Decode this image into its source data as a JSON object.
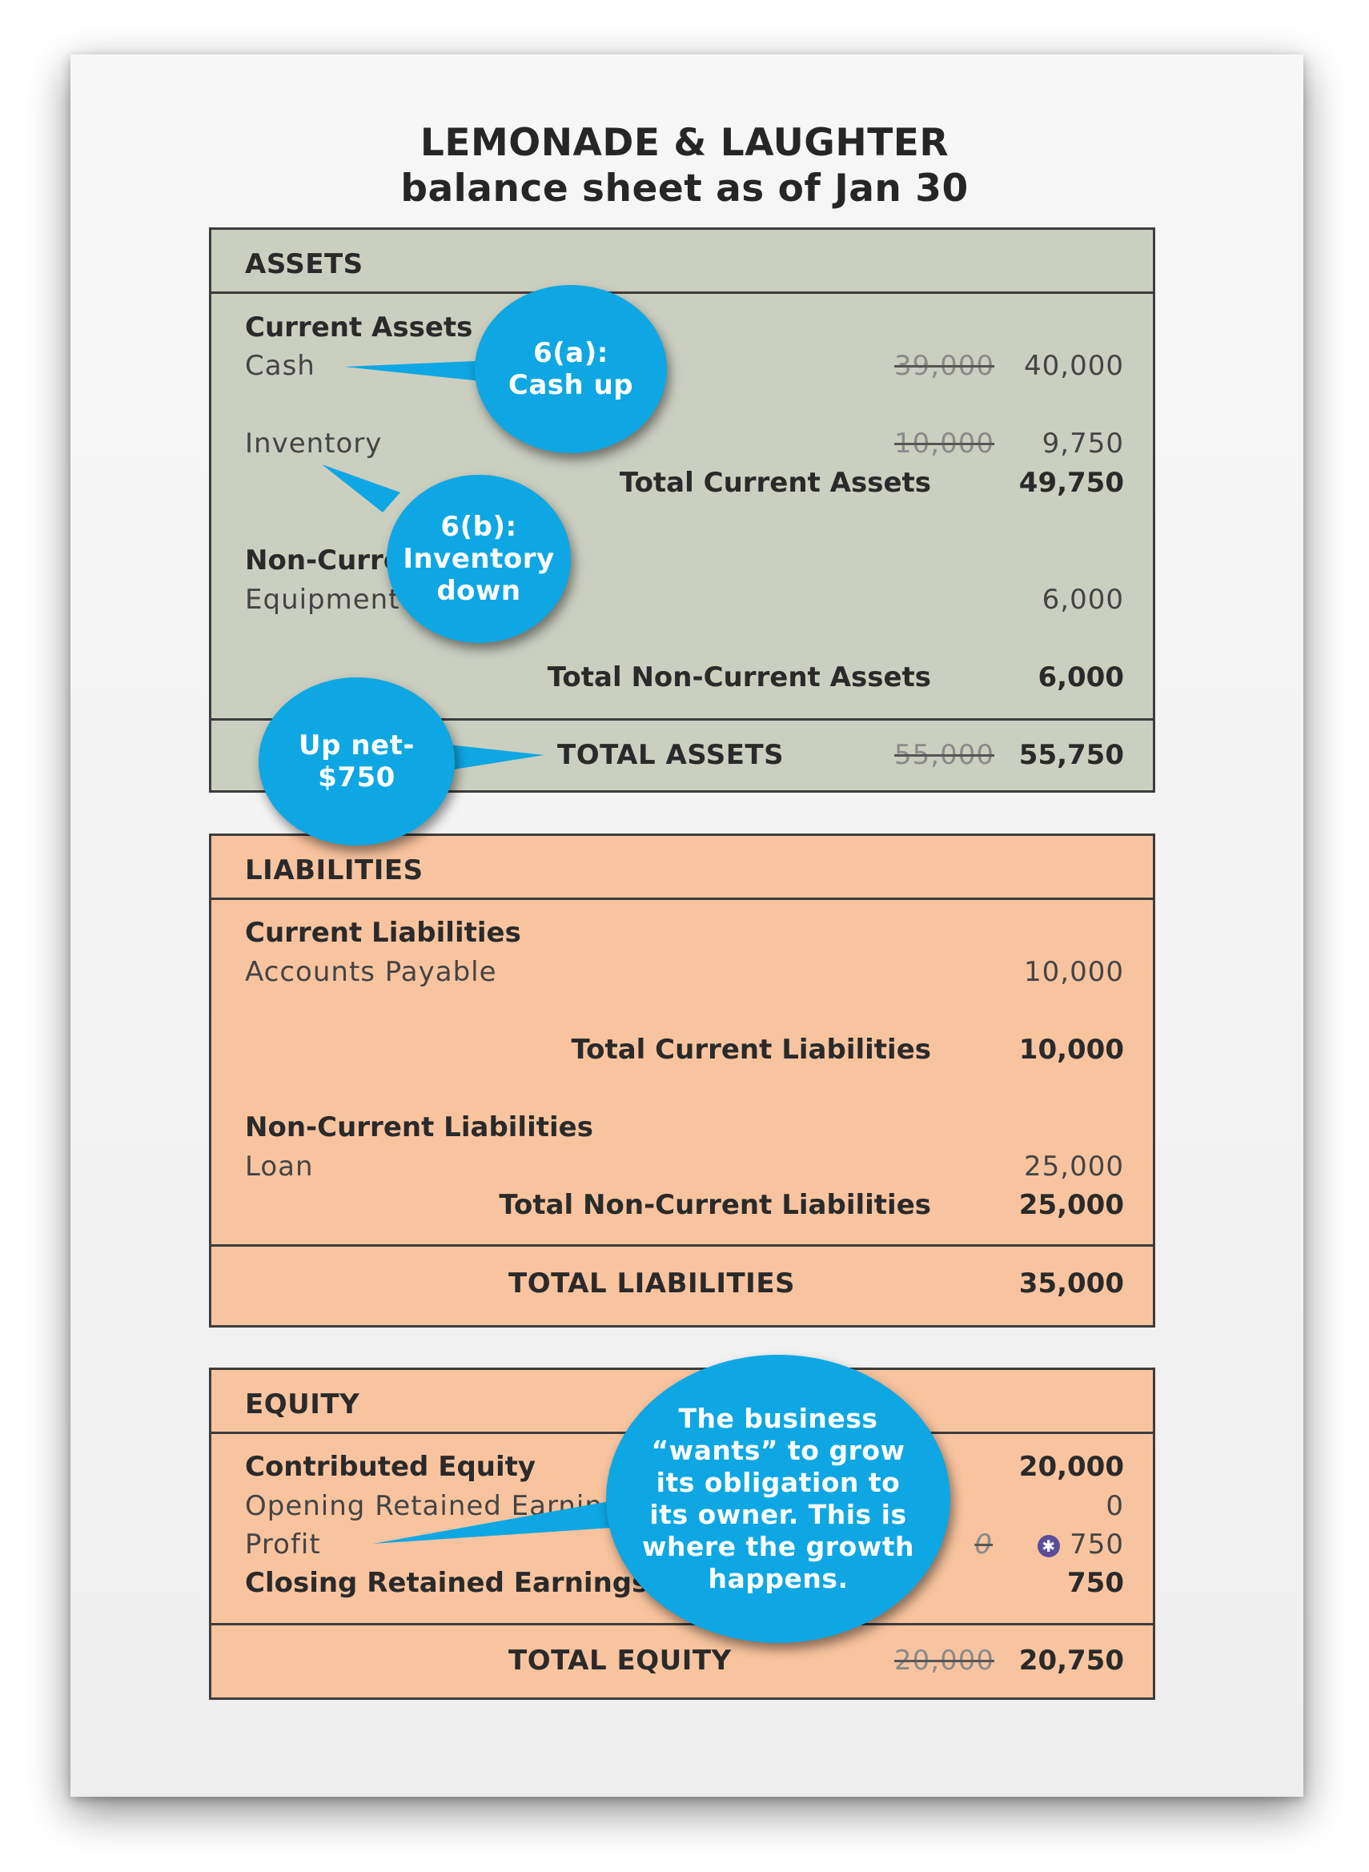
{
  "title": {
    "line1": "LEMONADE & LAUGHTER",
    "line2": "balance sheet as of Jan 30"
  },
  "assets": {
    "header": "ASSETS",
    "current_header": "Current Assets",
    "cash_label": "Cash",
    "cash_old": "39,000",
    "cash_value": "40,000",
    "inventory_label": "Inventory",
    "inventory_old": "10,000",
    "inventory_value": "9,750",
    "total_current_label": "Total Current Assets",
    "total_current_value": "49,750",
    "noncurrent_header": "Non-Current Assets",
    "equipment_label": "Equipment",
    "equipment_value": "6,000",
    "total_noncurrent_label": "Total Non-Current Assets",
    "total_noncurrent_value": "6,000",
    "total_label": "TOTAL ASSETS",
    "total_old": "55,000",
    "total_value": "55,750"
  },
  "liabilities": {
    "header": "LIABILITIES",
    "current_header": "Current Liabilities",
    "ap_label": "Accounts Payable",
    "ap_value": "10,000",
    "total_current_label": "Total Current Liabilities",
    "total_current_value": "10,000",
    "noncurrent_header": "Non-Current Liabilities",
    "loan_label": "Loan",
    "loan_value": "25,000",
    "total_noncurrent_label": "Total Non-Current Liabilities",
    "total_noncurrent_value": "25,000",
    "total_label": "TOTAL LIABILITIES",
    "total_value": "35,000"
  },
  "equity": {
    "header": "EQUITY",
    "contributed_label": "Contributed Equity",
    "contributed_value": "20,000",
    "opening_label": "Opening Retained Earnings",
    "opening_value": "0",
    "profit_label": "Profit",
    "profit_old": "0",
    "profit_value": "750",
    "closing_label": "Closing Retained Earnings",
    "closing_value": "750",
    "total_label": "TOTAL EQUITY",
    "total_old": "20,000",
    "total_value": "20,750"
  },
  "callouts": {
    "cash": [
      "6(a):",
      "Cash up"
    ],
    "inventory": [
      "6(b):",
      "Inventory",
      "down"
    ],
    "total_assets": [
      "Up net-",
      "$750"
    ],
    "equity": [
      "The business",
      "“wants” to grow",
      "its obligation to",
      "its owner. This is",
      "where the growth",
      "happens."
    ]
  },
  "colors": {
    "assets_bg": "#cbcfc0",
    "liabilities_bg": "#f8c49f",
    "callout_bg": "#0ea7e3"
  }
}
